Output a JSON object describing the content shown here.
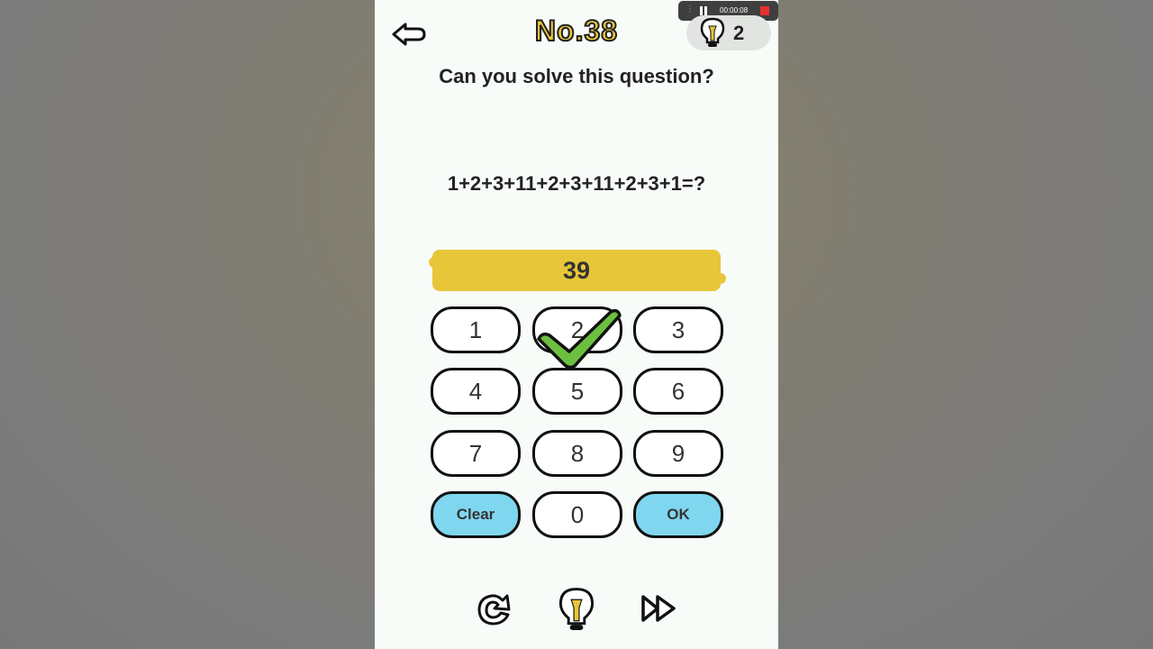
{
  "recorder": {
    "time": "00:00:08"
  },
  "header": {
    "level": "No.38",
    "hint_count": "2"
  },
  "subtitle": "Can you solve this question?",
  "question": "1+2+3+11+2+3+11+2+3+1=?",
  "answer": "39",
  "keypad": {
    "keys": [
      "1",
      "2",
      "3",
      "4",
      "5",
      "6",
      "7",
      "8",
      "9",
      "Clear",
      "0",
      "OK"
    ]
  },
  "colors": {
    "accent_yellow": "#e8c63a",
    "action_blue": "#7fd6ef",
    "check_green": "#6cbf3f"
  },
  "icons": [
    "back-arrow-icon",
    "lightbulb-icon",
    "check-icon",
    "restart-icon",
    "hint-icon",
    "skip-icon"
  ]
}
